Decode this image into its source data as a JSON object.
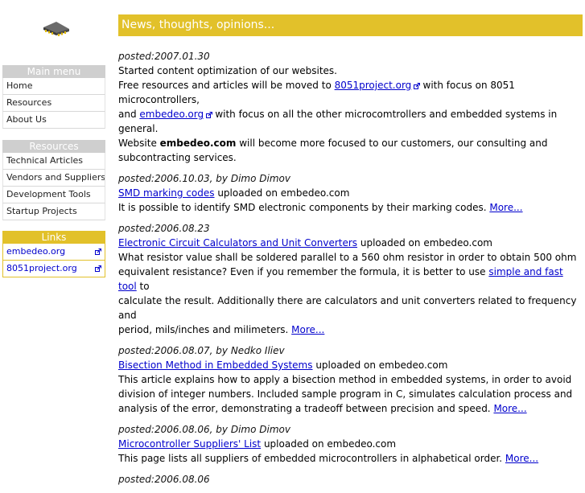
{
  "banner": {
    "title": "News, thoughts, opinions..."
  },
  "main_menu": {
    "heading": "Main menu",
    "items": [
      {
        "label": "Home"
      },
      {
        "label": "Resources"
      },
      {
        "label": "About Us"
      }
    ]
  },
  "resources_menu": {
    "heading": "Resources",
    "items": [
      {
        "label": "Technical Articles"
      },
      {
        "label": "Vendors and Suppliers"
      },
      {
        "label": "Development Tools"
      },
      {
        "label": "Startup Projects"
      }
    ]
  },
  "links_menu": {
    "heading": "Links",
    "items": [
      {
        "label": "embedeo.org"
      },
      {
        "label": "8051project.org"
      }
    ]
  },
  "posts": {
    "p1": {
      "posted": "posted:2007.01.30",
      "line1": "Started content optimization of our websites.",
      "line2_pre": "Free resources and articles will be moved to ",
      "link_8051": "8051project.org",
      "line2_post": " with focus on 8051 microcontrollers,",
      "line3_pre": "and ",
      "link_embedeo": "embedeo.org",
      "line3_post": " with focus on all the other microcomtrollers and embedded systems in general.",
      "line4_pre": "Website ",
      "brand": "embedeo.com",
      "line4_post": " will become more focused to our customers, our consulting and",
      "line5": "subcontracting services."
    },
    "p2": {
      "posted": "posted:2006.10.03, by Dimo Dimov",
      "link": "SMD marking codes",
      "link_suffix": " uploaded on embedeo.com",
      "text": "It is possible to identify SMD electronic components by their marking codes. ",
      "more": "More..."
    },
    "p3": {
      "posted": "posted:2006.08.23",
      "link": "Electronic Circuit Calculators and Unit Converters",
      "link_suffix": " uploaded on embedeo.com",
      "line1": "What resistor value shall be soldered parallel to a 560 ohm resistor in order to obtain 500 ohm",
      "line2_pre": "equivalent resistance? Even if you remember the formula, it is better to use ",
      "inline_link": "simple and fast tool",
      "line2_post": " to",
      "line3": "calculate the result. Additionally there are calculators and unit converters related to frequency and",
      "line4": "period, mils/inches and milimeters. ",
      "more": "More..."
    },
    "p4": {
      "posted": "posted:2006.08.07, by Nedko Iliev",
      "link": "Bisection Method in Embedded Systems",
      "link_suffix": " uploaded on embedeo.com",
      "line1": "This article explains how to apply a bisection method in embedded systems, in order to avoid",
      "line2": "division of integer numbers. Included sample program in C, simulates calculation process and",
      "line3": "analysis of the error, demonstrating a tradeoff between precision and speed. ",
      "more": "More..."
    },
    "p5": {
      "posted": "posted:2006.08.06, by Dimo Dimov",
      "link": "Microcontroller Suppliers' List",
      "link_suffix": " uploaded on embedeo.com",
      "text": "This page lists all suppliers of embedded microcontrollers in alphabetical order. ",
      "more": "More..."
    },
    "p6": {
      "posted": "posted:2006.08.06"
    }
  },
  "icons": {
    "logo": "chip-icon",
    "external": "external-link-icon"
  }
}
